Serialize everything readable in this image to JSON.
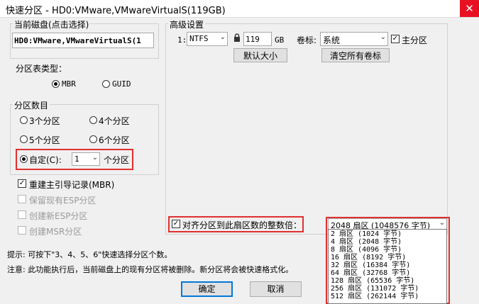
{
  "window": {
    "title": "快速分区 - HD0:VMware,VMwareVirtualS(119GB)",
    "close_glyph": "✕"
  },
  "disk_group": {
    "title": "当前磁盘(点击选择)",
    "value": "HD0:VMware,VMwareVirtualS(1"
  },
  "partition_table": {
    "title": "分区表类型：",
    "options": [
      "MBR",
      "GUID"
    ],
    "selected": "MBR"
  },
  "partition_count": {
    "title": "分区数目",
    "options": [
      "3个分区",
      "4个分区",
      "5个分区",
      "6个分区"
    ],
    "custom_label": "自定(C):",
    "custom_value": "1",
    "custom_suffix": "个分区",
    "selected": "custom"
  },
  "options": {
    "rebuild_mbr": "重建主引导记录(MBR)",
    "keep_esp": "保留现有ESP分区",
    "create_esp": "创建新ESP分区",
    "create_msr": "创建MSR分区"
  },
  "advanced": {
    "title": "高级设置",
    "row_label": "1:",
    "fs_value": "NTFS",
    "size_value": "119",
    "size_unit": "GB",
    "volume_label_caption": "卷标:",
    "volume_label_value": "系统",
    "primary_label": "主分区",
    "default_size_button": "默认大小",
    "clear_labels_button": "清空所有卷标"
  },
  "align": {
    "label": "对齐分区到此扇区数的整数倍：",
    "selected": "2048 扇区 (1048576 字节)",
    "items": [
      "2 扇区 (1024 字节)",
      "4 扇区 (2048 字节)",
      "8 扇区 (4096 字节)",
      "16 扇区 (8192 字节)",
      "32 扇区 (16384 字节)",
      "64 扇区 (32768 字节)",
      "128 扇区 (65536 字节)",
      "256 扇区 (131072 字节)",
      "512 扇区 (262144 字节)"
    ]
  },
  "hints": {
    "tip": "提示: 可按下\"3、4、5、6\"快速选择分区个数。",
    "note": "注意: 此功能执行后，当前磁盘上的现有分区将被删除。新分区将会被快速格式化。"
  },
  "buttons": {
    "ok": "确定",
    "cancel": "取消"
  },
  "colors": {
    "highlight": "#e03030",
    "focus": "#0078d7"
  },
  "icons": {
    "lock": "lock-icon",
    "dropdown": "chevron-down-icon"
  }
}
